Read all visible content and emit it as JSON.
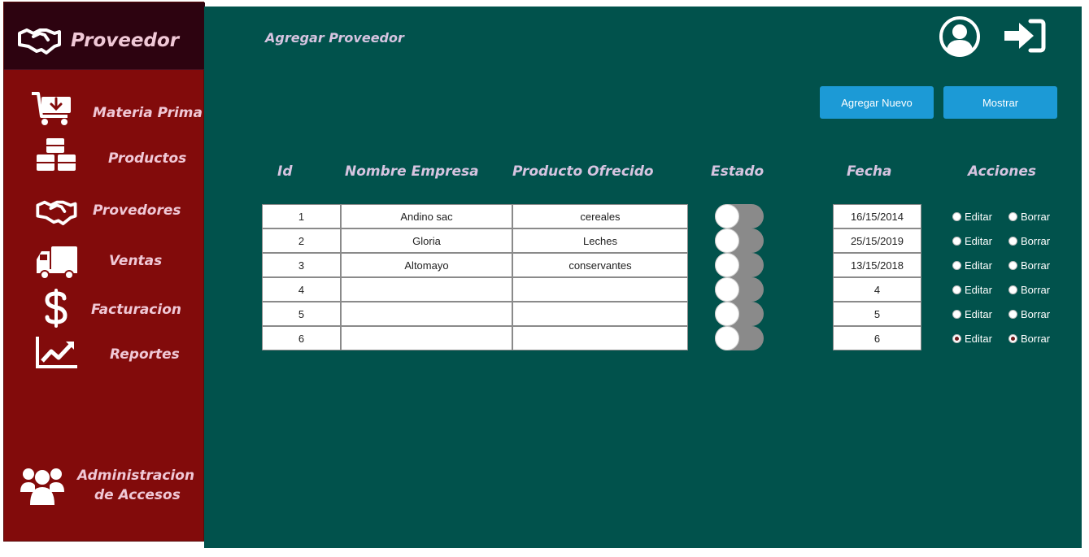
{
  "app": {
    "title": "Proveedor"
  },
  "sidebar": {
    "items": [
      {
        "label": "Materia Prima",
        "icon": "cart-download-icon"
      },
      {
        "label": "Productos",
        "icon": "boxes-icon"
      },
      {
        "label": "Provedores",
        "icon": "handshake-icon"
      },
      {
        "label": "Ventas",
        "icon": "truck-icon"
      },
      {
        "label": "Facturacion",
        "icon": "dollar-icon"
      },
      {
        "label": "Reportes",
        "icon": "chart-line-icon"
      }
    ],
    "admin": {
      "line1": "Administracion",
      "line2": "de Accesos",
      "icon": "users-icon"
    }
  },
  "header": {
    "title": "Agregar Proveedor",
    "user_icon": "user-circle-icon",
    "logout_icon": "sign-in-icon"
  },
  "toolbar": {
    "add_label": "Agregar Nuevo",
    "show_label": "Mostrar"
  },
  "table": {
    "columns": [
      "Id",
      "Nombre Empresa",
      "Producto Ofrecido",
      "Estado",
      "Fecha",
      "Acciones"
    ],
    "rows": [
      {
        "id": "1",
        "empresa": "Andino sac",
        "producto": "cereales",
        "fecha": "16/15/2014",
        "editar_selected": false,
        "borrar_selected": false
      },
      {
        "id": "2",
        "empresa": "Gloria",
        "producto": "Leches",
        "fecha": "25/15/2019",
        "editar_selected": false,
        "borrar_selected": false
      },
      {
        "id": "3",
        "empresa": "Altomayo",
        "producto": "conservantes",
        "fecha": "13/15/2018",
        "editar_selected": false,
        "borrar_selected": false
      },
      {
        "id": "4",
        "empresa": "",
        "producto": "",
        "fecha": "4",
        "editar_selected": false,
        "borrar_selected": false
      },
      {
        "id": "5",
        "empresa": "",
        "producto": "",
        "fecha": "5",
        "editar_selected": false,
        "borrar_selected": false
      },
      {
        "id": "6",
        "empresa": "",
        "producto": "",
        "fecha": "6",
        "editar_selected": true,
        "borrar_selected": true
      }
    ],
    "action_edit": "Editar",
    "action_delete": "Borrar"
  },
  "colors": {
    "sidebar_bg": "#820b0b",
    "brand_bg": "#2d0310",
    "main_bg": "#01524c",
    "button_bg": "#1c9ad6",
    "nav_text": "#f0c8d6"
  }
}
